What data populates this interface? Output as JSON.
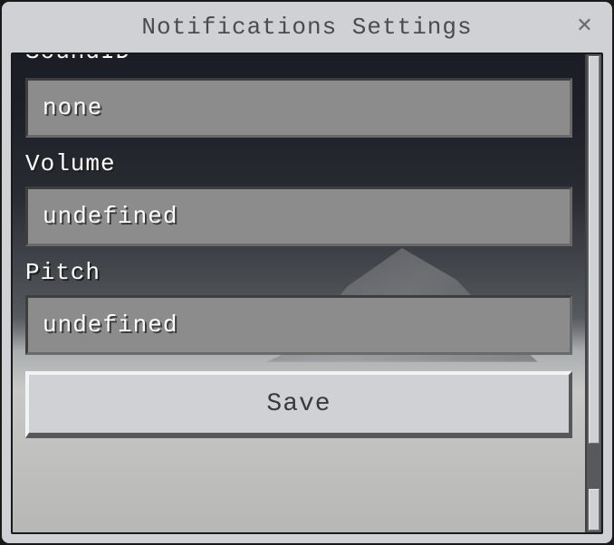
{
  "window": {
    "title": "Notifications Settings"
  },
  "form": {
    "fields": [
      {
        "label": "SoundID",
        "value": "none"
      },
      {
        "label": "Volume",
        "value": "undefined"
      },
      {
        "label": "Pitch",
        "value": "undefined"
      }
    ],
    "save_label": "Save"
  }
}
